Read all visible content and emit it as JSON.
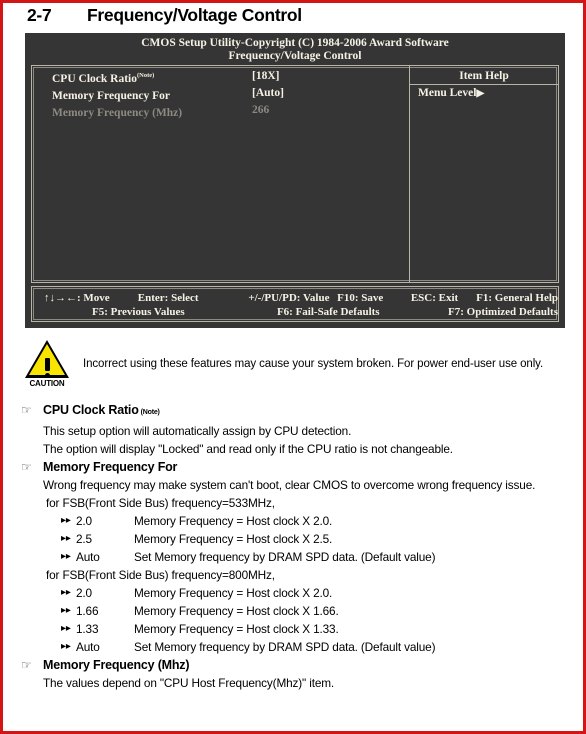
{
  "section": {
    "number": "2-7",
    "title": "Frequency/Voltage Control"
  },
  "bios": {
    "title_line1": "CMOS Setup Utility-Copyright (C) 1984-2006 Award Software",
    "title_line2": "Frequency/Voltage Control",
    "menu_items": [
      {
        "label": "CPU Clock Ratio",
        "note": "(Note)",
        "value": "[18X]",
        "state": "enabled"
      },
      {
        "label": "Memory Frequency For",
        "note": "",
        "value": "[Auto]",
        "state": "enabled"
      },
      {
        "label": "Memory Frequency (Mhz)",
        "note": "",
        "value": "266",
        "state": "disabled"
      }
    ],
    "item_help": {
      "title": "Item Help",
      "menu_level_label": "Menu Level",
      "menu_level_arrow": "▶"
    },
    "footer": {
      "row1": [
        "↑↓→←: Move",
        "Enter: Select",
        "+/-/PU/PD: Value",
        "F10: Save",
        "ESC: Exit",
        "F1: General Help"
      ],
      "row2": [
        "F5: Previous Values",
        "F6: Fail-Safe Defaults",
        "F7: Optimized Defaults"
      ]
    }
  },
  "caution": {
    "label": "CAUTION",
    "text": "Incorrect using these features may cause your system broken. For power end-user use only."
  },
  "doc": {
    "hand_icon": "☞",
    "arrow_icon": "▸▸",
    "blocks": [
      {
        "heading": "CPU Clock Ratio",
        "note": "(Note)",
        "lines": [
          "This setup option will automatically assign by CPU detection.",
          "The option will display \"Locked\" and read only if the CPU ratio is not changeable."
        ],
        "groups": []
      },
      {
        "heading": "Memory Frequency For",
        "note": "",
        "lines": [
          "Wrong frequency may make system can't boot, clear CMOS to overcome wrong frequency issue."
        ],
        "groups": [
          {
            "intro": "for FSB(Front Side Bus) frequency=533MHz,",
            "options": [
              {
                "key": "2.0",
                "desc": "Memory Frequency = Host clock X 2.0."
              },
              {
                "key": "2.5",
                "desc": "Memory Frequency = Host clock X 2.5."
              },
              {
                "key": "Auto",
                "desc": "Set Memory frequency by DRAM SPD data. (Default value)"
              }
            ]
          },
          {
            "intro": "for FSB(Front Side Bus) frequency=800MHz,",
            "options": [
              {
                "key": "2.0",
                "desc": "Memory Frequency = Host clock X 2.0."
              },
              {
                "key": "1.66",
                "desc": "Memory Frequency = Host clock X 1.66."
              },
              {
                "key": "1.33",
                "desc": "Memory Frequency = Host clock X 1.33."
              },
              {
                "key": "Auto",
                "desc": "Set Memory frequency by DRAM SPD data. (Default value)"
              }
            ]
          }
        ]
      },
      {
        "heading": "Memory Frequency (Mhz)",
        "note": "",
        "lines": [
          "The values depend on \"CPU Host Frequency(Mhz)\" item."
        ],
        "groups": []
      }
    ]
  },
  "colors": {
    "page_border": "#d31515",
    "bios_bg": "#353535",
    "bios_fg": "#f5f1e4",
    "bios_disabled": "#8d8a82",
    "caution_yellow": "#f7e500"
  }
}
